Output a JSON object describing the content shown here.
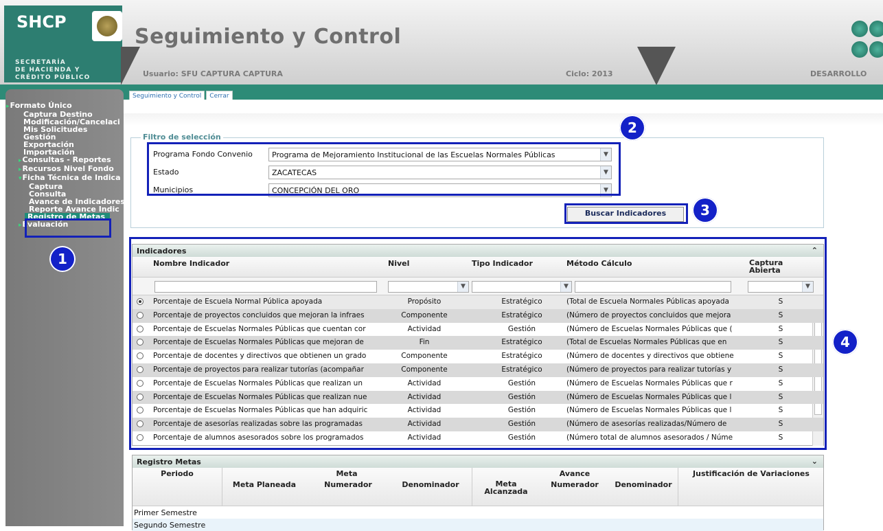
{
  "header": {
    "logo": "SHCP",
    "logo_sub_1": "SECRETARÍA",
    "logo_sub_2": "DE HACIENDA Y",
    "logo_sub_3": "CRÉDITO PÚBLICO",
    "app_title": "Seguimiento y Control",
    "user": "Usuario: SFU CAPTURA CAPTURA",
    "ciclo": "Ciclo: 2013",
    "environment": "DESARROLLO"
  },
  "tabs": [
    {
      "label": "Seguimiento y Control"
    },
    {
      "label": "Cerrar"
    }
  ],
  "sidebar": {
    "items": [
      {
        "label": "Formato Único"
      },
      {
        "label": "Captura Destino"
      },
      {
        "label": "Modificación/Cancelaci"
      },
      {
        "label": "Mis Solicitudes"
      },
      {
        "label": "Gestión"
      },
      {
        "label": "Exportación"
      },
      {
        "label": "Importación"
      },
      {
        "label": "Consultas - Reportes"
      },
      {
        "label": "Recursos Nivel Fondo"
      },
      {
        "label": "Ficha Técnica de Indica"
      },
      {
        "label": "Captura"
      },
      {
        "label": "Consulta"
      },
      {
        "label": "Avance de Indicadores"
      },
      {
        "label": "Reporte Avance Indic"
      },
      {
        "label": "Registro de Metas"
      },
      {
        "label": "Evaluación"
      }
    ]
  },
  "filter": {
    "legend": "Filtro de selección",
    "programa_label": "Programa Fondo Convenio",
    "programa_value": "Programa de Mejoramiento Institucional de las Escuelas Normales Públicas",
    "estado_label": "Estado",
    "estado_value": "ZACATECAS",
    "municipio_label": "Municipios",
    "municipio_value": "CONCEPCIÓN DEL ORO",
    "search_button": "Buscar Indicadores"
  },
  "indicadores": {
    "title": "Indicadores",
    "headers": {
      "nombre": "Nombre Indicador",
      "nivel": "Nivel",
      "tipo": "Tipo Indicador",
      "metodo": "Método Cálculo",
      "captura_1": "Captura",
      "captura_2": "Abierta"
    },
    "rows": [
      {
        "nombre": "Porcentaje de Escuela Normal Pública apoyada",
        "nivel": "Propósito",
        "tipo": "Estratégico",
        "metodo": "(Total de Escuela Normales Públicas apoyada",
        "captura": "S"
      },
      {
        "nombre": "Porcentaje de proyectos concluidos que mejoran la infraes",
        "nivel": "Componente",
        "tipo": "Estratégico",
        "metodo": "(Número de proyectos concluidos que mejora",
        "captura": "S"
      },
      {
        "nombre": "Porcentaje de Escuelas Normales Públicas que cuentan cor",
        "nivel": "Actividad",
        "tipo": "Gestión",
        "metodo": "(Número de Escuelas Normales Públicas que (",
        "captura": "S"
      },
      {
        "nombre": "Porcentaje de Escuelas Normales Públicas que mejoran de",
        "nivel": "Fin",
        "tipo": "Estratégico",
        "metodo": "(Total de Escuelas Normales Públicas que en",
        "captura": "S"
      },
      {
        "nombre": "Porcentaje de docentes y directivos que obtienen un grado",
        "nivel": "Componente",
        "tipo": "Estratégico",
        "metodo": "(Número de docentes y directivos que obtiene",
        "captura": "S"
      },
      {
        "nombre": "Porcentaje de proyectos para realizar tutorías (acompañar",
        "nivel": "Componente",
        "tipo": "Estratégico",
        "metodo": "(Número de proyectos para realizar tutorías y",
        "captura": "S"
      },
      {
        "nombre": "Porcentaje de Escuelas Normales Públicas que realizan un",
        "nivel": "Actividad",
        "tipo": "Gestión",
        "metodo": "(Número de Escuelas Normales Públicas que r",
        "captura": "S"
      },
      {
        "nombre": "Porcentaje de Escuelas Normales Públicas que realizan nue",
        "nivel": "Actividad",
        "tipo": "Gestión",
        "metodo": "(Número de Escuelas Normales Públicas que l",
        "captura": "S"
      },
      {
        "nombre": "Porcentaje de Escuelas Normales Públicas que han adquiric",
        "nivel": "Actividad",
        "tipo": "Gestión",
        "metodo": "(Número de Escuelas Normales Públicas que l",
        "captura": "S"
      },
      {
        "nombre": "Porcentaje de asesorías realizadas sobre las programadas",
        "nivel": "Actividad",
        "tipo": "Gestión",
        "metodo": "(Número de asesorías realizadas/Número de",
        "captura": "S"
      },
      {
        "nombre": "Porcentaje de alumnos asesorados sobre los programados",
        "nivel": "Actividad",
        "tipo": "Gestión",
        "metodo": "(Número total de alumnos asesorados / Núme",
        "captura": "S"
      }
    ]
  },
  "registro": {
    "title": "Registro Metas",
    "periodo": "Periodo",
    "meta": "Meta",
    "meta_planeada": "Meta Planeada",
    "numerador": "Numerador",
    "denominador": "Denominador",
    "avance": "Avance",
    "meta_alcanzada_1": "Meta",
    "meta_alcanzada_2": "Alcanzada",
    "avance_numerador": "Numerador",
    "avance_denominador": "Denominador",
    "justificacion": "Justificación de Variaciones",
    "periods": [
      "Primer Semestre",
      "Segundo Semestre"
    ]
  },
  "badges": [
    "1",
    "2",
    "3",
    "4"
  ],
  "colors": {
    "brand_green": "#2d7e71",
    "highlight_blue": "#1321b8"
  }
}
